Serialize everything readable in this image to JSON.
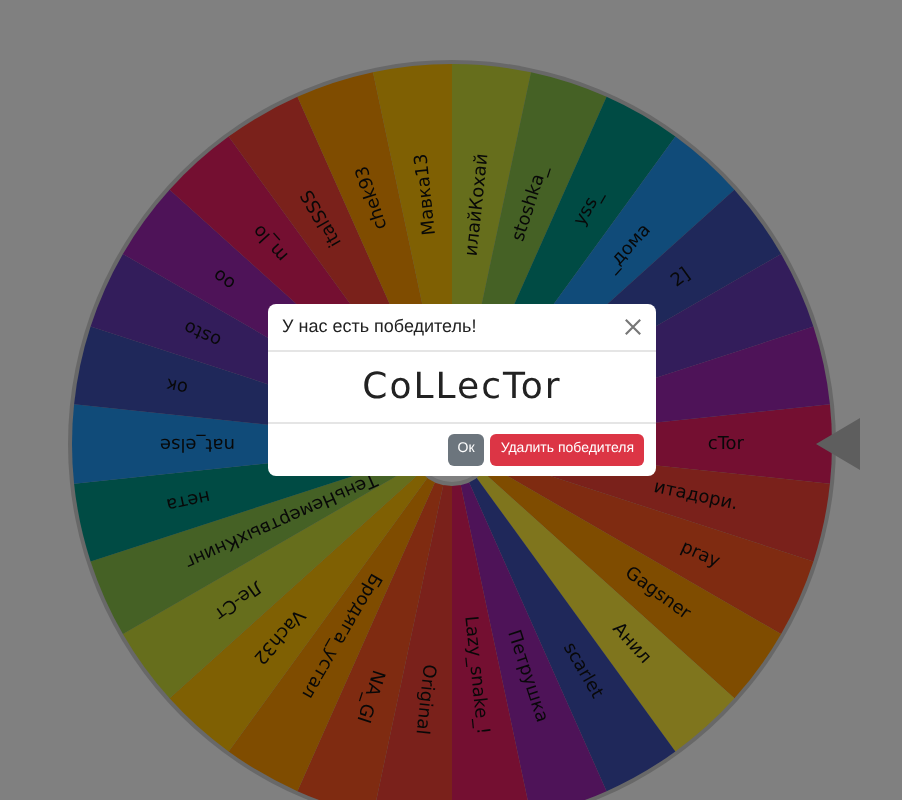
{
  "wheel": {
    "labels": [
      "cTor",
      "итадори.",
      "pray",
      "Gagsner",
      "Анил",
      "scarlet",
      "Петрушка",
      "Lazy_snake_!",
      "Original",
      "NA_Gl",
      "Бродяга_устал",
      "Vach32",
      "Ле-Ст",
      "ТеньНемертвыхКнинг",
      "нета",
      "nat_else",
      "ок",
      "osto",
      "oo",
      "m_lo",
      "italSSS",
      "chek93",
      "Мавка13",
      "илайКохай",
      "stoshka_",
      "yss_",
      "_дома",
      "2]"
    ]
  },
  "modal": {
    "title": "У нас есть победитель!",
    "winner": "CoLLecTor",
    "buttons": [
      {
        "label": "Ок",
        "kind": "secondary"
      },
      {
        "label": "Удалить победителя",
        "kind": "danger"
      }
    ]
  }
}
